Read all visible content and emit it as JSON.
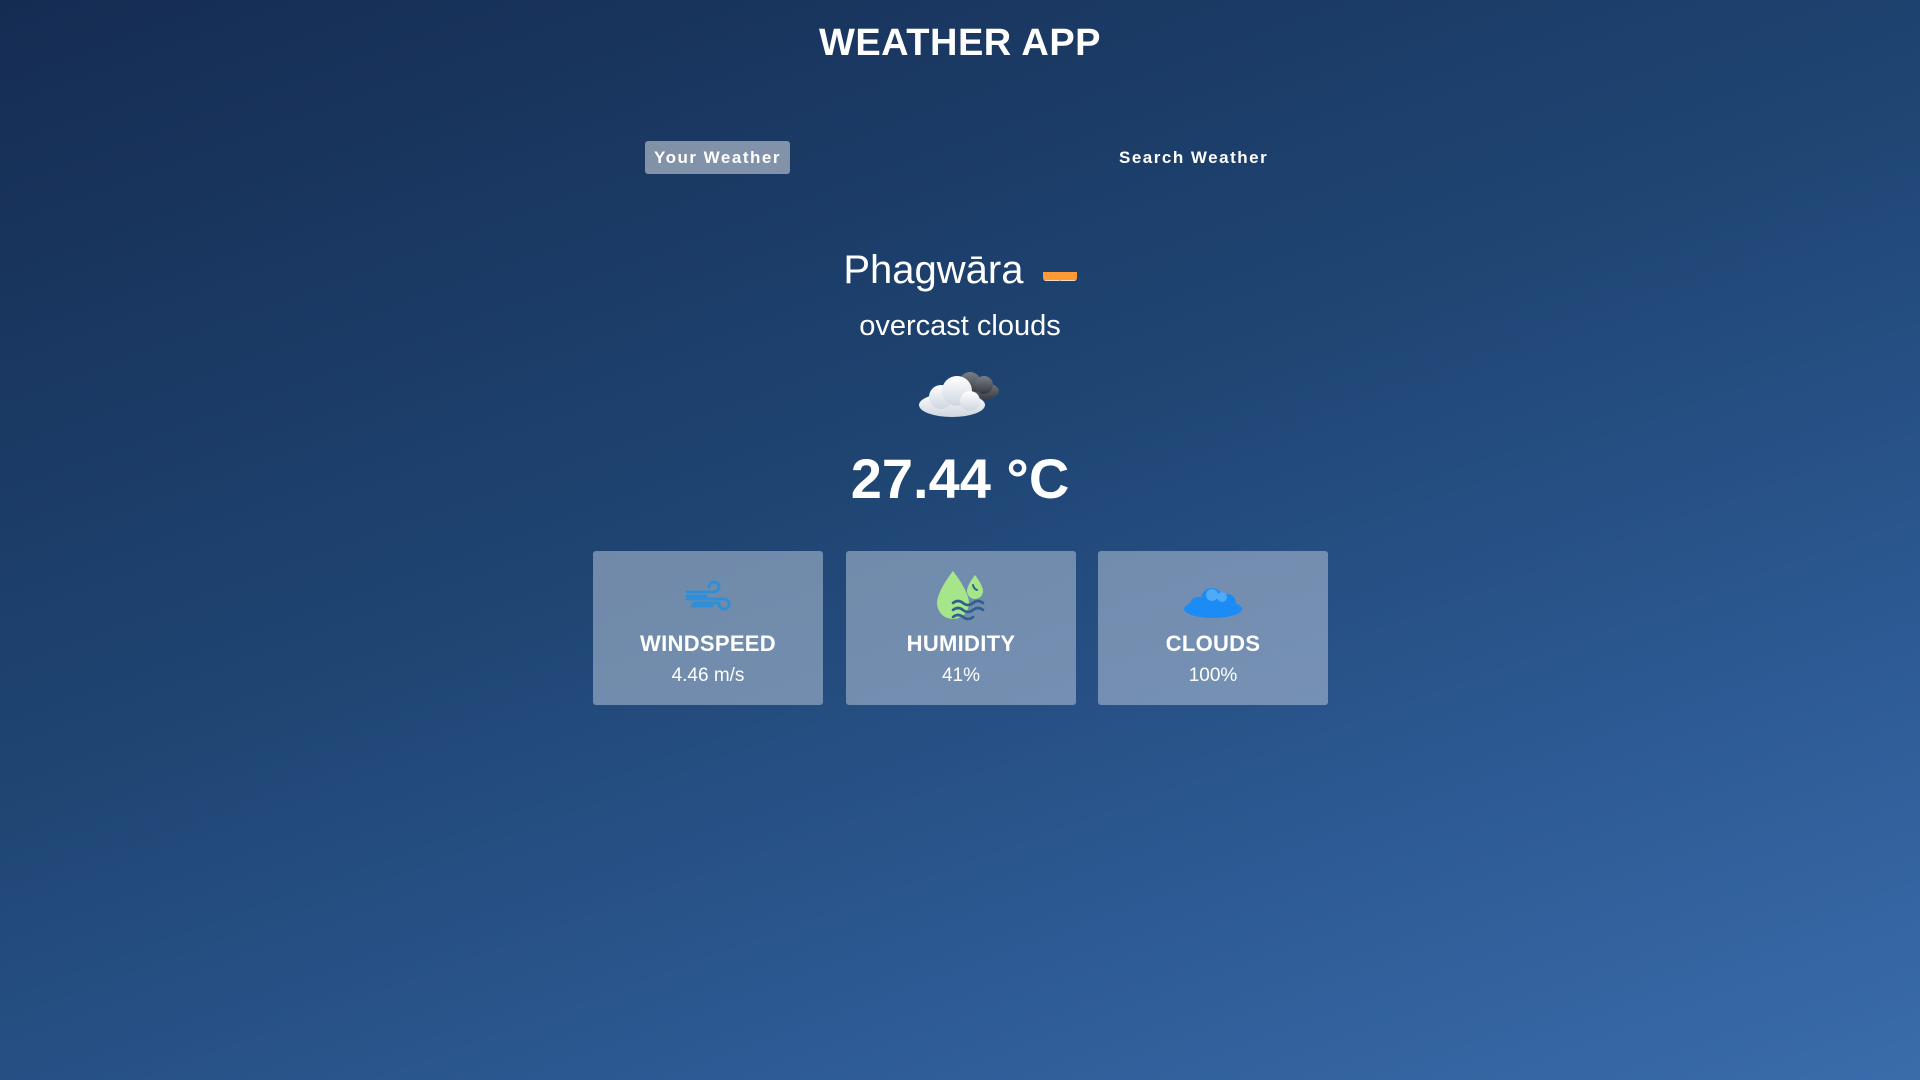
{
  "app": {
    "title": "WEATHER APP"
  },
  "tabs": [
    {
      "label": "Your Weather",
      "active": true
    },
    {
      "label": "Search Weather",
      "active": false
    }
  ],
  "location": {
    "city": "Phagwāra",
    "flag_icon": "india-flag-icon"
  },
  "weather": {
    "description": "overcast clouds",
    "icon": "overcast-clouds-icon",
    "temperature": "27.44 °C"
  },
  "stats": [
    {
      "label": "WINDSPEED",
      "value": "4.46 m/s",
      "icon": "wind-icon",
      "color": "#2f8fd6"
    },
    {
      "label": "HUMIDITY",
      "value": "41%",
      "icon": "humidity-drop-icon",
      "color": "#a6e58a"
    },
    {
      "label": "CLOUDS",
      "value": "100%",
      "icon": "cloud-icon",
      "color": "#1b8bf5"
    }
  ],
  "colors": {
    "background_top": "#152c52",
    "background_bottom": "#3a6cab",
    "text": "#ffffff"
  }
}
